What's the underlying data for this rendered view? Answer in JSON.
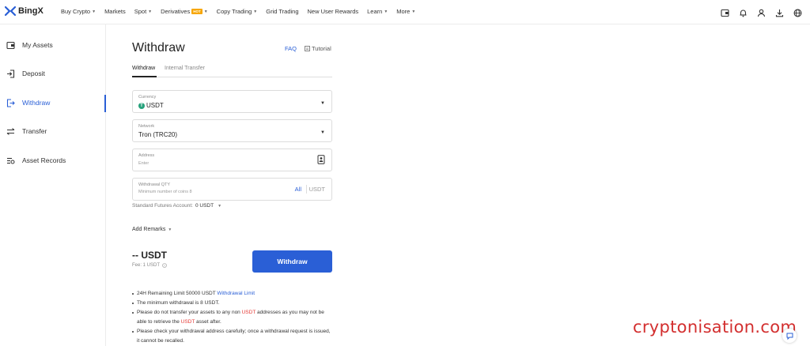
{
  "brand": {
    "name": "BingX"
  },
  "nav": [
    {
      "label": "Buy Crypto",
      "caret": true
    },
    {
      "label": "Markets",
      "caret": false
    },
    {
      "label": "Spot",
      "caret": true
    },
    {
      "label": "Derivatives",
      "caret": true,
      "badge": "HOT"
    },
    {
      "label": "Copy Trading",
      "caret": true
    },
    {
      "label": "Grid Trading",
      "caret": false
    },
    {
      "label": "New User Rewards",
      "caret": false
    },
    {
      "label": "Learn",
      "caret": true
    },
    {
      "label": "More",
      "caret": true
    }
  ],
  "top_icons": [
    "wallet-icon",
    "bell-icon",
    "user-icon",
    "download-icon",
    "globe-icon"
  ],
  "sidebar": {
    "items": [
      {
        "label": "My Assets",
        "icon": "wallet-icon"
      },
      {
        "label": "Deposit",
        "icon": "deposit-icon"
      },
      {
        "label": "Withdraw",
        "icon": "withdraw-icon",
        "active": true
      },
      {
        "label": "Transfer",
        "icon": "transfer-icon"
      },
      {
        "label": "Asset Records",
        "icon": "records-icon"
      }
    ]
  },
  "page": {
    "title": "Withdraw",
    "faq": "FAQ",
    "tutorial": "Tutorial",
    "tabs": [
      "Withdraw",
      "Internal Transfer"
    ]
  },
  "form": {
    "currency": {
      "label": "Currency",
      "value": "USDT",
      "coin_symbol": "T"
    },
    "network": {
      "label": "Network",
      "value": "Tron (TRC20)"
    },
    "address": {
      "label": "Address",
      "placeholder": "Enter"
    },
    "qty": {
      "label": "Withdrawal QTY",
      "placeholder": "Minimum number of coins 8",
      "all": "All",
      "unit": "USDT"
    },
    "futures": {
      "label": "Standard Futures Account:",
      "value": "0 USDT"
    },
    "remarks": "Add Remarks",
    "amount": "-- USDT",
    "fee": "Fee:  1 USDT",
    "submit": "Withdraw"
  },
  "notes": {
    "n1_pre": "24H Remaining Limit 50000 USDT ",
    "n1_link": "Withdrawal Limit",
    "n2": "The minimum withdrawal is 8 USDT.",
    "n3_a": "Please do not transfer your assets to any non ",
    "n3_b": "USDT",
    "n3_c": " addresses as you may not be able to retrieve the ",
    "n3_d": "USDT",
    "n3_e": " asset after.",
    "n4": "Please check your withdrawal address carefully; once a withdrawal request is issued, it cannot be recalled."
  },
  "watermark": "cryptonisation.com",
  "colors": {
    "accent": "#2a5fd6",
    "usdt": "#26a17b",
    "warning": "#e53935",
    "hot": "#f7a600"
  }
}
